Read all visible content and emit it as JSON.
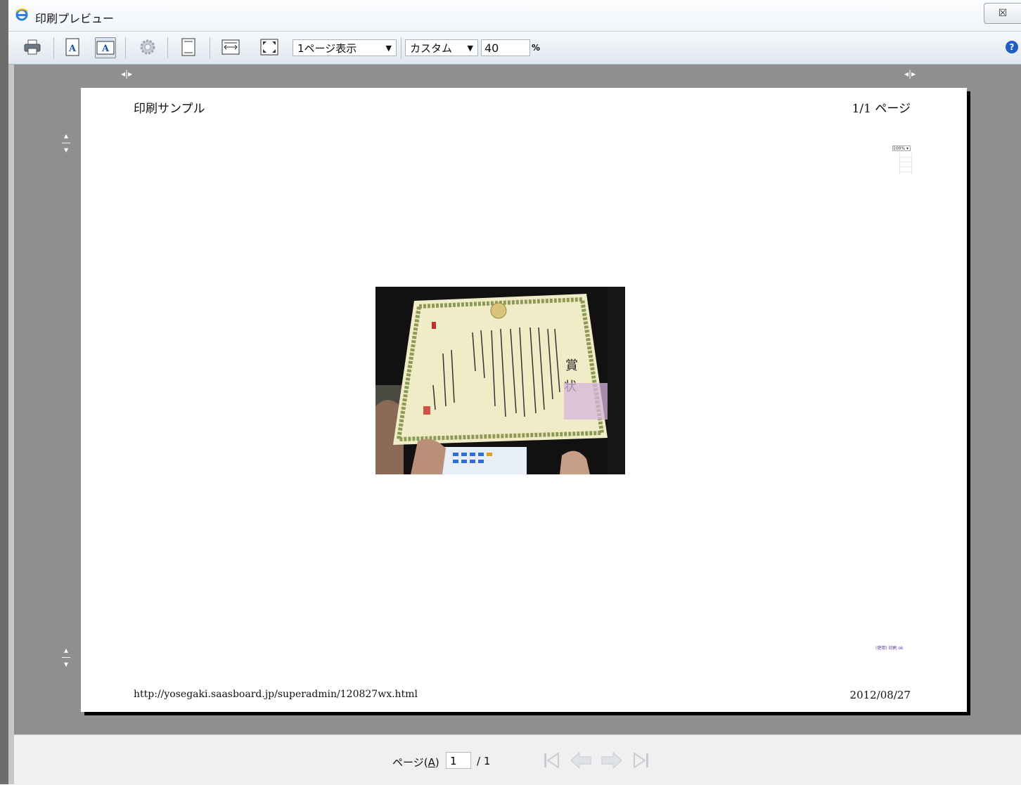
{
  "window": {
    "title": "印刷プレビュー",
    "close_glyph": "☒"
  },
  "toolbar": {
    "view_mode": "1ページ表示",
    "zoom_mode": "カスタム",
    "zoom_value": "40",
    "zoom_unit": "%",
    "help_glyph": "?"
  },
  "page": {
    "header_left": "印刷サンプル",
    "header_right": "1/1 ページ",
    "footer_left": "http://yosegaki.saasboard.jp/superadmin/120827wx.html",
    "footer_right": "2012/08/27",
    "mini_select_text": "100% ▾",
    "mini_footer_text": "(使用) 印刷 ok"
  },
  "nav": {
    "page_label": "ページ(A)",
    "page_label_mnemonic": "A",
    "current_page": "1",
    "total_pages": "/ 1"
  },
  "colors": {
    "preview_bg": "#8f8f8f",
    "accent_blue": "#1f5fbf"
  }
}
